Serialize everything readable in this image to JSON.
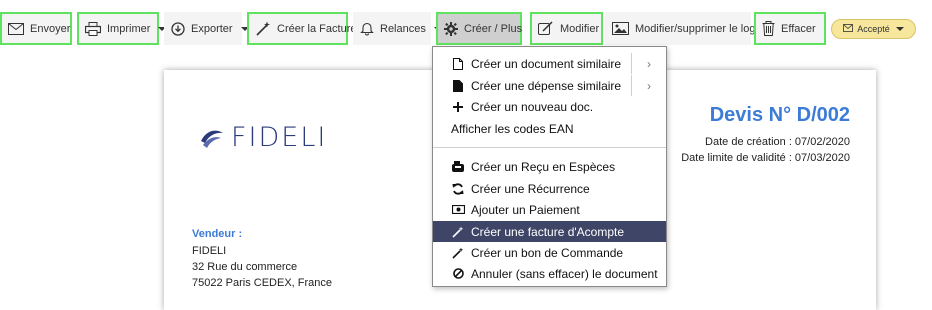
{
  "toolbar": {
    "send": "Envoyer",
    "print": "Imprimer",
    "export": "Exporter",
    "create_invoice": "Créer la Facture",
    "reminders": "Relances",
    "create_more": "Créer / Plus",
    "edit": "Modifier",
    "edit_logo": "Modifier/supprimer le logo",
    "delete": "Effacer",
    "status": "Accepté"
  },
  "document": {
    "logo_text": "FIDELI",
    "title": "Devis N° D/002",
    "created": "Date de création : 07/02/2020",
    "valid_until": "Date limite de validité : 07/03/2020",
    "seller_label": "Vendeur :",
    "seller_name": "FIDELI",
    "seller_street": "32 Rue du commerce",
    "seller_city": "75022 Paris CEDEX, France"
  },
  "menu": {
    "similar_doc": "Créer un document similaire",
    "similar_expense": "Créer une dépense similaire",
    "new_doc": "Créer un nouveau doc.",
    "ean_codes": "Afficher les codes EAN",
    "cash_receipt": "Créer un Reçu en Espèces",
    "recurrence": "Créer une Récurrence",
    "add_payment": "Ajouter un Paiement",
    "deposit_invoice": "Créer une facture d'Acompte",
    "purchase_order": "Créer un bon de Commande",
    "cancel_doc": "Annuler (sans effacer) le document",
    "submenu_arrow": "›"
  },
  "colors": {
    "highlight": "#5fe35f",
    "accent_blue": "#3c7bd6",
    "menu_active": "#3e4566",
    "status_pill": "#f6e79c"
  }
}
